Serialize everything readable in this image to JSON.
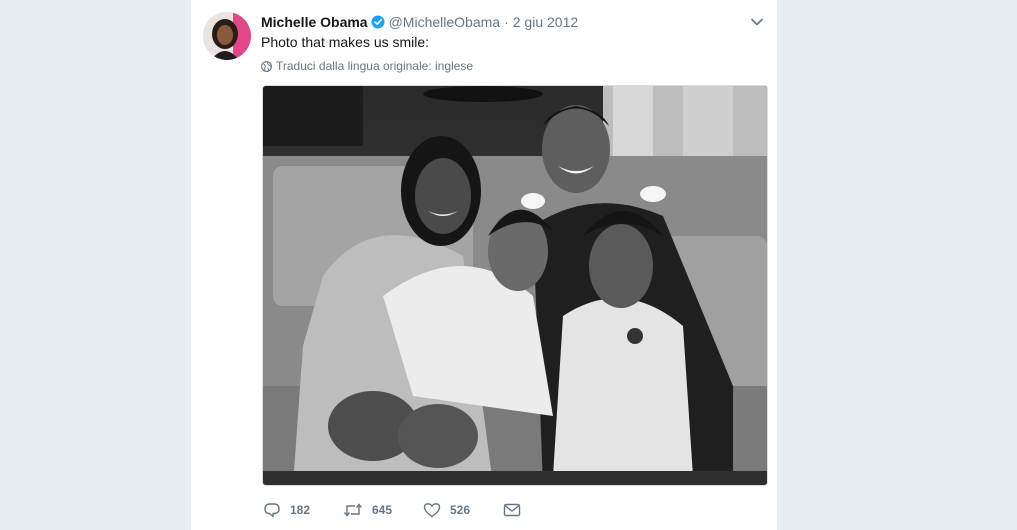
{
  "tweet": {
    "author_name": "Michelle Obama",
    "author_handle": "@MichelleObama",
    "separator": "·",
    "date": "2 giu 2012",
    "text": "Photo that makes us smile:",
    "translate_label": "Traduci dalla lingua originale: inglese",
    "verified": true,
    "photo_style": "black-and-white"
  },
  "actions": {
    "reply_count": "182",
    "retweet_count": "645",
    "like_count": "526"
  },
  "icons": {
    "verified": "verified-badge-icon",
    "caret": "chevron-down-icon",
    "globe": "globe-icon",
    "reply": "reply-icon",
    "retweet": "retweet-icon",
    "like": "heart-icon",
    "dm": "envelope-icon"
  },
  "colors": {
    "background": "#e6ecf0",
    "card": "#ffffff",
    "text_primary": "#14171a",
    "text_secondary": "#657786",
    "verified_blue": "#1da1f2"
  }
}
